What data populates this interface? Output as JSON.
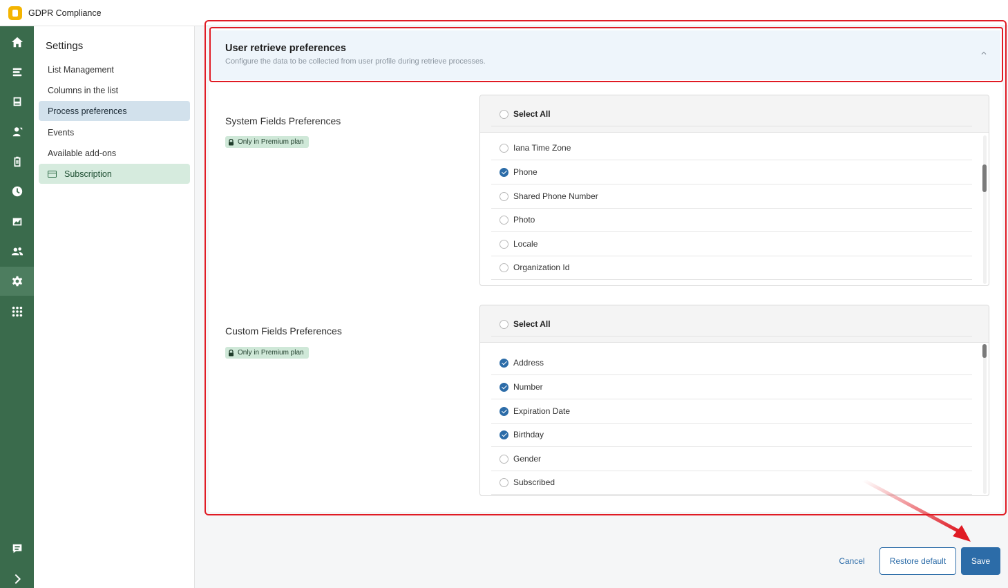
{
  "app": {
    "title": "GDPR Compliance"
  },
  "rail": {
    "items": [
      {
        "icon": "home-icon"
      },
      {
        "icon": "list-icon"
      },
      {
        "icon": "inbox-icon"
      },
      {
        "icon": "user-export-icon"
      },
      {
        "icon": "clipboard-icon"
      },
      {
        "icon": "clock-icon"
      },
      {
        "icon": "chart-icon"
      },
      {
        "icon": "users-icon"
      },
      {
        "icon": "gear-icon",
        "active": true
      },
      {
        "icon": "apps-grid-icon"
      },
      {
        "icon": "chat-icon"
      },
      {
        "icon": "chevron-right-icon"
      }
    ]
  },
  "settings": {
    "title": "Settings",
    "items": [
      {
        "label": "List Management"
      },
      {
        "label": "Columns in the list"
      },
      {
        "label": "Process preferences",
        "active": true
      },
      {
        "label": "Events"
      },
      {
        "label": "Available add-ons"
      },
      {
        "label": "Subscription"
      }
    ]
  },
  "section": {
    "title": "User retrieve preferences",
    "subtitle": "Configure the data to be collected from user profile during retrieve processes."
  },
  "system_fields": {
    "title": "System Fields Preferences",
    "badge": "Only in Premium plan",
    "select_all": {
      "label": "Select All",
      "checked": false
    },
    "rows": [
      {
        "label": "Iana Time Zone",
        "checked": false
      },
      {
        "label": "Phone",
        "checked": true
      },
      {
        "label": "Shared Phone Number",
        "checked": false
      },
      {
        "label": "Photo",
        "checked": false
      },
      {
        "label": "Locale",
        "checked": false
      },
      {
        "label": "Organization Id",
        "checked": false
      }
    ]
  },
  "custom_fields": {
    "title": "Custom Fields Preferences",
    "badge": "Only in Premium plan",
    "select_all": {
      "label": "Select All",
      "checked": false
    },
    "rows": [
      {
        "label": "Address",
        "checked": true
      },
      {
        "label": "Number",
        "checked": true
      },
      {
        "label": "Expiration Date",
        "checked": true
      },
      {
        "label": "Birthday",
        "checked": true
      },
      {
        "label": "Gender",
        "checked": false
      },
      {
        "label": "Subscribed",
        "checked": false
      }
    ]
  },
  "footer": {
    "cancel": "Cancel",
    "restore": "Restore default",
    "save": "Save"
  },
  "colors": {
    "rail": "#3a6b4c",
    "accent": "#2c6ca8",
    "highlight": "#e01b24"
  }
}
